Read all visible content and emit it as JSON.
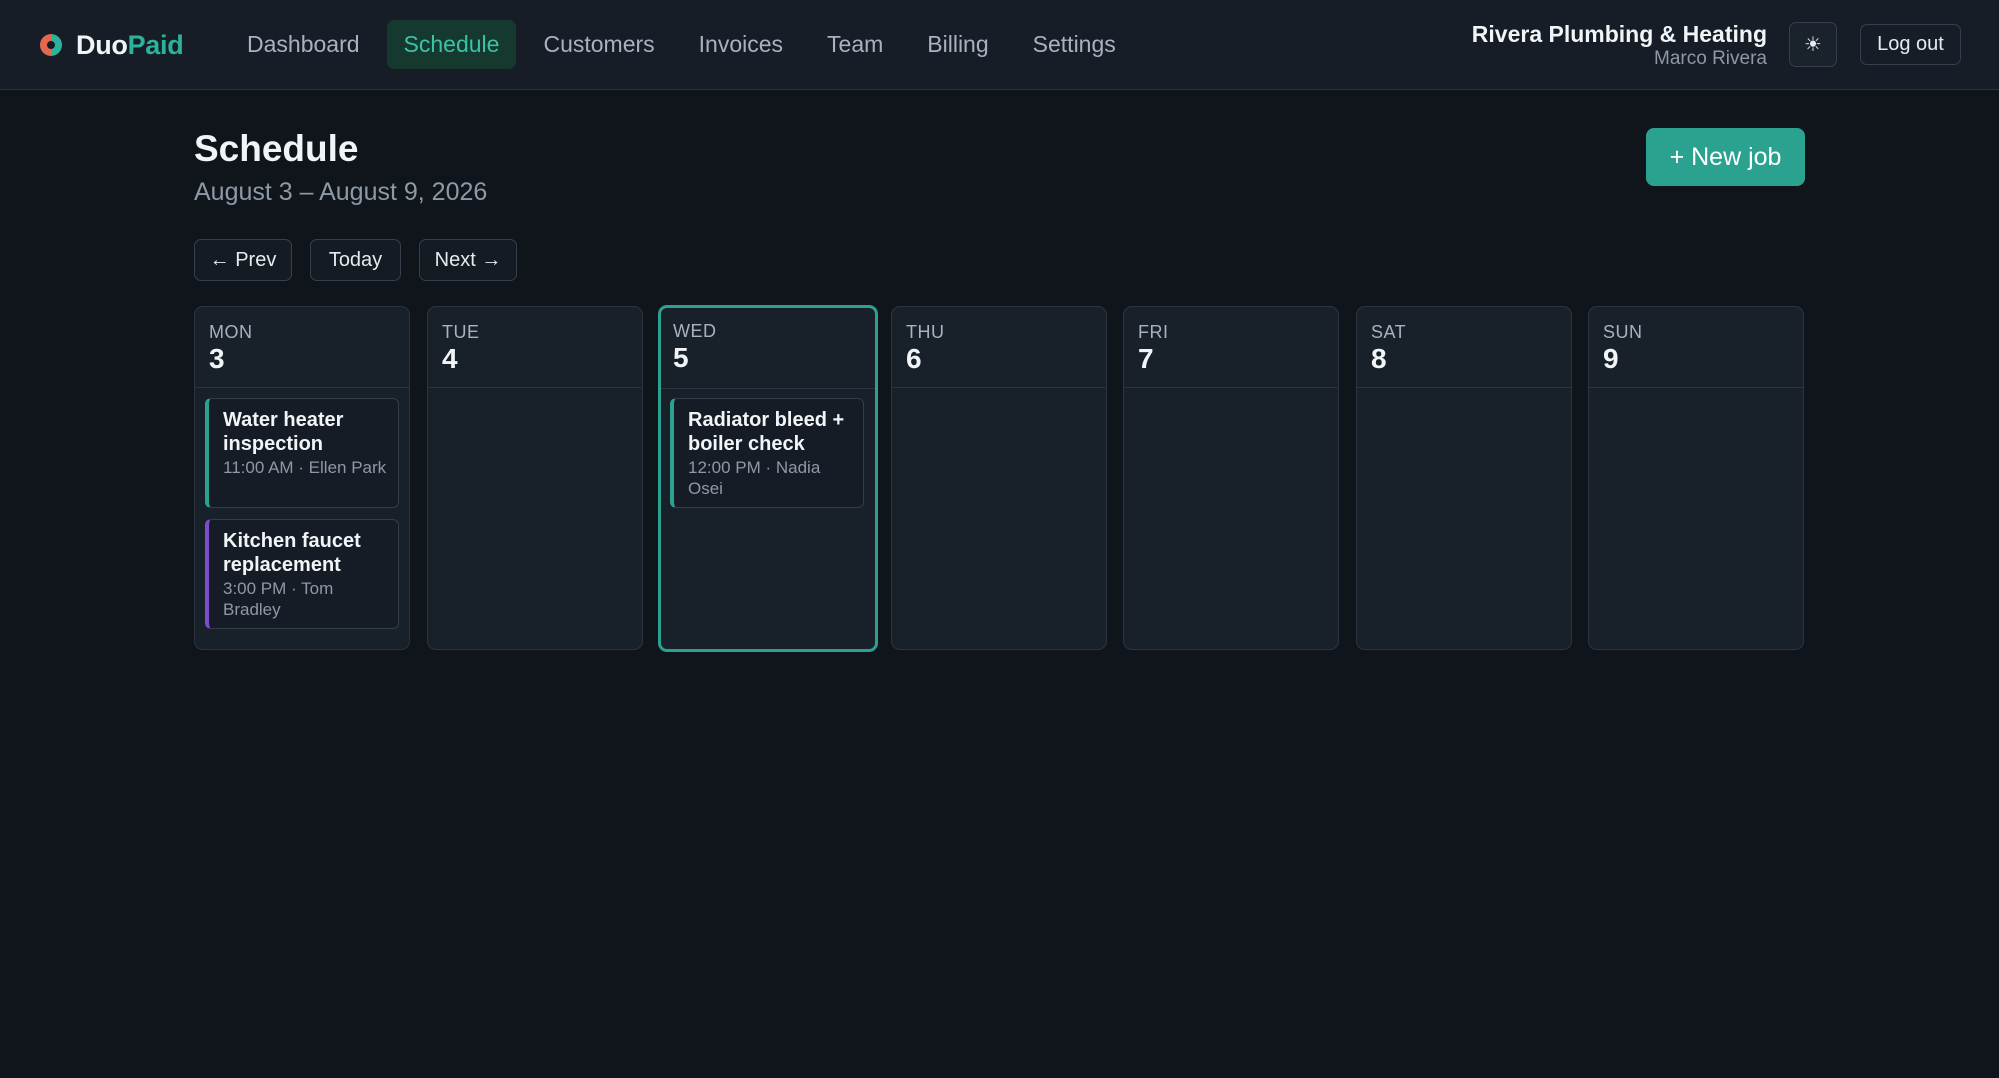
{
  "brand": {
    "part1": "Duo",
    "part2": "Paid"
  },
  "nav": {
    "items": [
      {
        "label": "Dashboard"
      },
      {
        "label": "Schedule"
      },
      {
        "label": "Customers"
      },
      {
        "label": "Invoices"
      },
      {
        "label": "Team"
      },
      {
        "label": "Billing"
      },
      {
        "label": "Settings"
      }
    ],
    "active": "Schedule"
  },
  "account": {
    "company": "Rivera Plumbing & Heating",
    "user": "Marco Rivera",
    "theme_icon": "sun-icon",
    "logout_label": "Log out"
  },
  "page": {
    "title": "Schedule",
    "subtitle": "August 3 – August 9, 2026",
    "new_job_label": "+ New job"
  },
  "week_nav": {
    "prev_label": "← Prev",
    "today_label": "Today",
    "next_label": "Next →"
  },
  "calendar": {
    "today_index": 2,
    "days": [
      {
        "name": "MON",
        "num": "3"
      },
      {
        "name": "TUE",
        "num": "4"
      },
      {
        "name": "WED",
        "num": "5"
      },
      {
        "name": "THU",
        "num": "6"
      },
      {
        "name": "FRI",
        "num": "7"
      },
      {
        "name": "SAT",
        "num": "8"
      },
      {
        "name": "SUN",
        "num": "9"
      }
    ],
    "jobs": {
      "mon_1": {
        "title": "Water heater inspection",
        "meta": "11:00 AM · Ellen Park",
        "color": "#2ba290"
      },
      "mon_2": {
        "title": "Kitchen faucet replacement",
        "meta": "3:00 PM · Tom Bradley",
        "color": "#7b4fc9"
      },
      "wed_1": {
        "title": "Radiator bleed + boiler check",
        "meta": "12:00 PM · Nadia Osei",
        "color": "#2ba290"
      }
    }
  },
  "colors": {
    "accent": "#2ba290",
    "background": "#10151c",
    "purple_tag": "#7b4fc9"
  }
}
